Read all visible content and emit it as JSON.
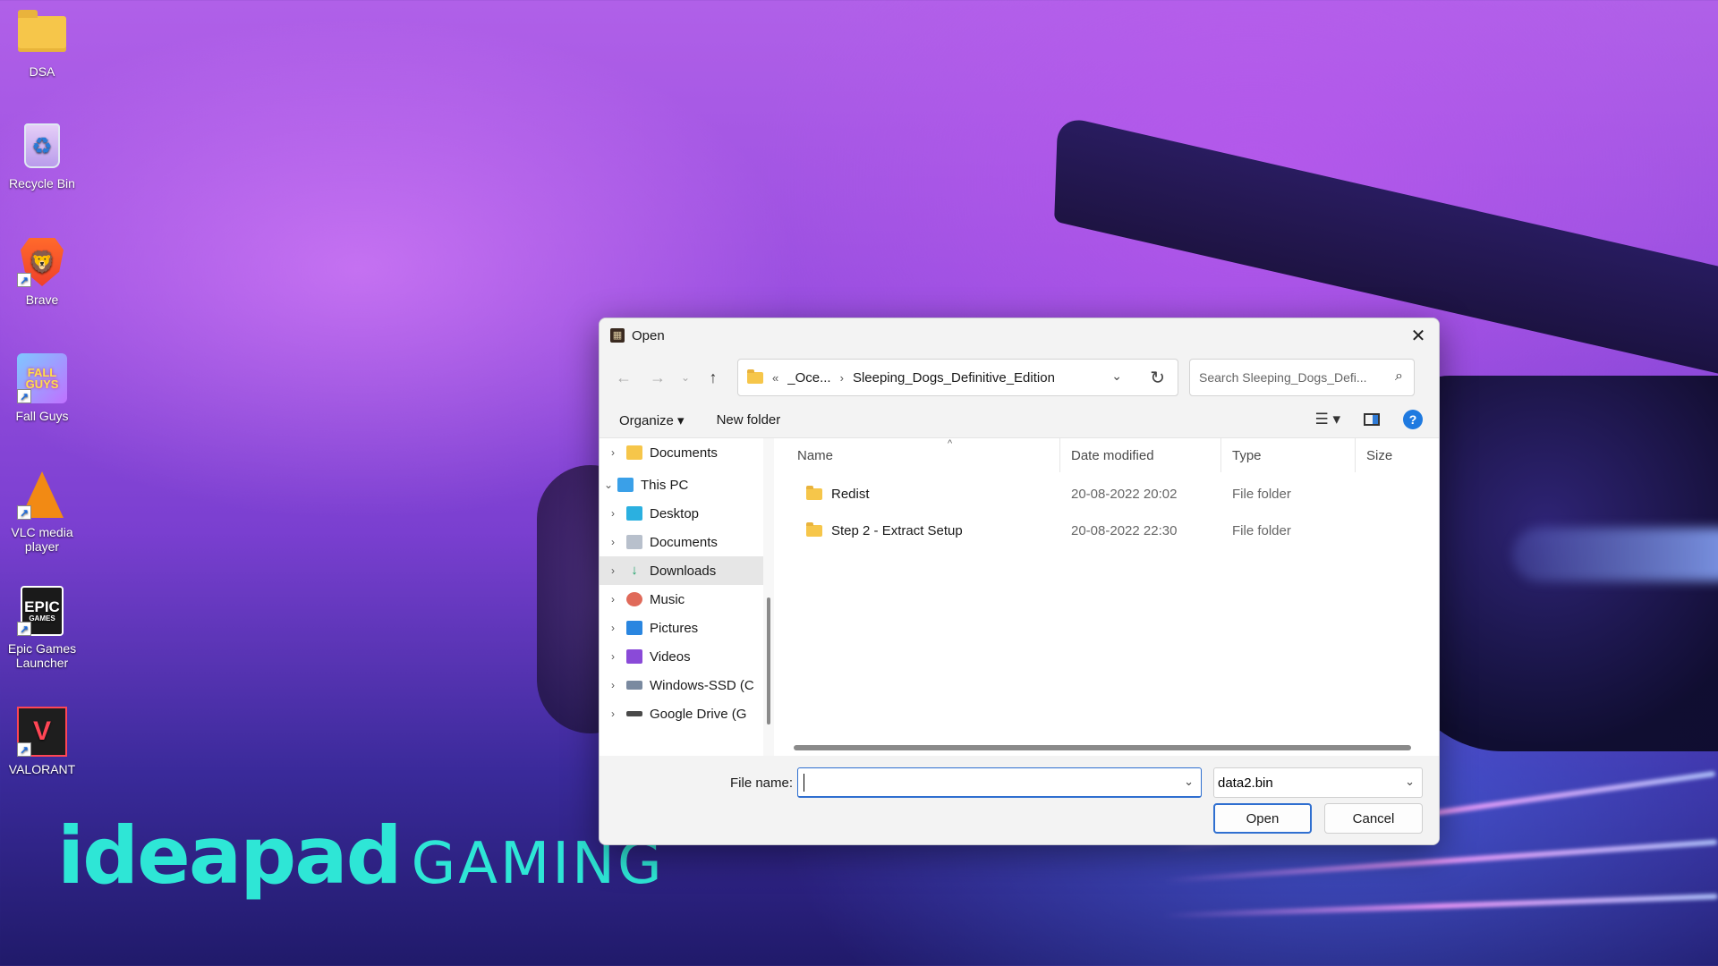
{
  "desktop": {
    "icons": [
      {
        "label": "DSA"
      },
      {
        "label": "Recycle Bin"
      },
      {
        "label": "Brave"
      },
      {
        "label": "Fall Guys"
      },
      {
        "label": "VLC media player"
      },
      {
        "label": "Epic Games Launcher"
      },
      {
        "label": "VALORANT"
      }
    ],
    "brand": {
      "part1": "ideapad",
      "part2": "GAMING"
    },
    "brand_color": "#2ee6d6"
  },
  "dialog": {
    "title": "Open",
    "address": {
      "overflow": "«",
      "crumb1": "_Oce...",
      "crumb2": "Sleeping_Dogs_Definitive_Edition"
    },
    "search_placeholder": "Search Sleeping_Dogs_Defi...",
    "toolbar": {
      "organize": "Organize ▾",
      "new_folder": "New folder"
    },
    "tree": [
      {
        "label": "Documents",
        "expand": "›",
        "icon": "folder-icon"
      },
      {
        "label": "This PC",
        "expand": "⌄",
        "icon": "computer-icon"
      },
      {
        "label": "Desktop",
        "expand": "›",
        "icon": "desktop-icon"
      },
      {
        "label": "Documents",
        "expand": "›",
        "icon": "documents-icon"
      },
      {
        "label": "Downloads",
        "expand": "›",
        "icon": "download-icon",
        "selected": true
      },
      {
        "label": "Music",
        "expand": "›",
        "icon": "music-icon"
      },
      {
        "label": "Pictures",
        "expand": "›",
        "icon": "pictures-icon"
      },
      {
        "label": "Videos",
        "expand": "›",
        "icon": "videos-icon"
      },
      {
        "label": "Windows-SSD (C",
        "expand": "›",
        "icon": "drive-icon"
      },
      {
        "label": "Google Drive (G",
        "expand": "›",
        "icon": "drive-icon"
      }
    ],
    "columns": {
      "name": "Name",
      "date": "Date modified",
      "type": "Type",
      "size": "Size"
    },
    "files": [
      {
        "name": "Redist",
        "date": "20-08-2022 20:02",
        "type": "File folder"
      },
      {
        "name": "Step 2 - Extract Setup",
        "date": "20-08-2022 22:30",
        "type": "File folder"
      }
    ],
    "footer": {
      "file_name_label": "File name:",
      "file_name_value": "",
      "filter_value": "data2.bin",
      "open_label": "Open",
      "cancel_label": "Cancel"
    },
    "accent_color": "#2f6fd0"
  }
}
